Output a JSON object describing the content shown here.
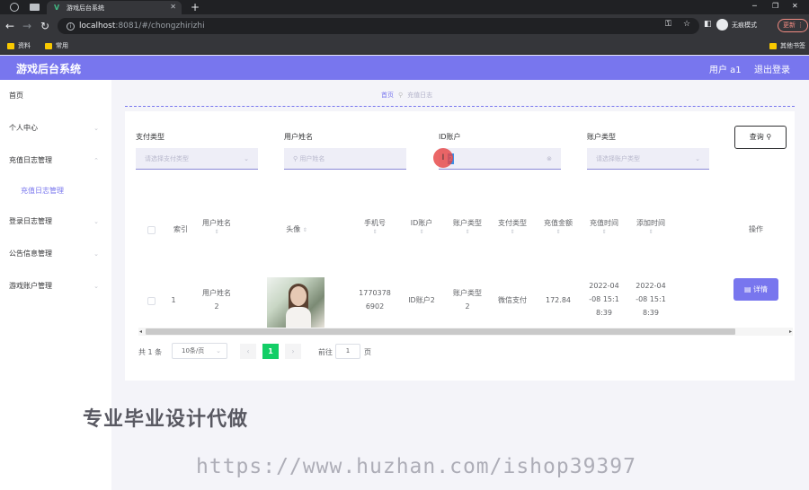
{
  "browser": {
    "tab_title": "游戏后台系统",
    "tab_favicon": "V",
    "new_tab": "+",
    "url_host": "localhost",
    "url_path": ":8081/#/chongzhirizhi",
    "incognito_label": "无痕模式",
    "update_label": "更新",
    "bookmarks": [
      "资料",
      "常用"
    ],
    "other_bookmarks": "其他书签"
  },
  "header": {
    "title": "游戏后台系统",
    "user_label": "用户 a1",
    "logout_label": "退出登录"
  },
  "sidebar": {
    "items": [
      {
        "label": "首页"
      },
      {
        "label": "个人中心"
      },
      {
        "label": "充值日志管理"
      },
      {
        "label": "充值日志管理"
      },
      {
        "label": "登录日志管理"
      },
      {
        "label": "公告信息管理"
      },
      {
        "label": "游戏账户管理"
      }
    ]
  },
  "breadcrumb": {
    "home": "首页",
    "current": "充值日志"
  },
  "filters": {
    "pay_type": {
      "label": "支付类型",
      "placeholder": "请选择支付类型"
    },
    "user_name": {
      "label": "用户姓名",
      "placeholder": "用户姓名"
    },
    "id_account": {
      "label": "ID账户",
      "value": "2"
    },
    "account_type": {
      "label": "账户类型",
      "placeholder": "请选择账户类型"
    },
    "query_button": "查询"
  },
  "table": {
    "columns": [
      "索引",
      "用户姓名",
      "头像",
      "手机号",
      "ID账户",
      "账户类型",
      "支付类型",
      "充值金额",
      "充值时间",
      "添加时间",
      "操作"
    ],
    "rows": [
      {
        "index": "1",
        "user_name_1": "用户姓名",
        "user_name_2": "2",
        "phone_1": "1770378",
        "phone_2": "6902",
        "id_account": "ID账户2",
        "account_type_1": "账户类型",
        "account_type_2": "2",
        "pay_type": "微信支付",
        "amount": "172.84",
        "charge_time_1": "2022-04",
        "charge_time_2": "-08 15:1",
        "charge_time_3": "8:39",
        "add_time_1": "2022-04",
        "add_time_2": "-08 15:1",
        "add_time_3": "8:39",
        "action": "详情"
      }
    ]
  },
  "pagination": {
    "total": "共 1 条",
    "page_size": "10条/页",
    "current_page": "1",
    "goto_label": "前往",
    "goto_value": "1",
    "page_unit": "页"
  },
  "overlay": {
    "watermark_text": "专业毕业设计代做",
    "watermark_url": "https://www.huzhan.com/ishop39397"
  }
}
